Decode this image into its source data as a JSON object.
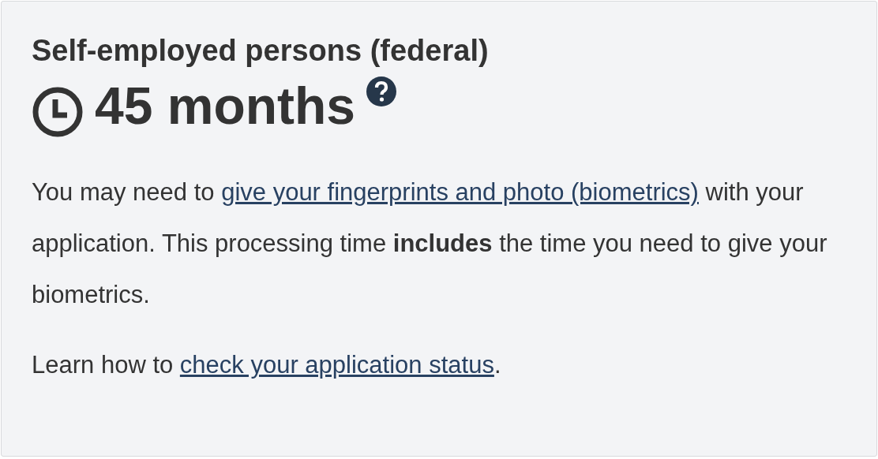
{
  "title": "Self-employed persons (federal)",
  "duration": "45 months",
  "paragraphs": [
    [
      {
        "kind": "text",
        "text": "You may need to "
      },
      {
        "kind": "link",
        "text": "give your fingerprints and photo (biometrics)"
      },
      {
        "kind": "text",
        "text": " with your application. This processing time **includes** the time you need to give your biometrics."
      }
    ],
    [
      {
        "kind": "text",
        "text": "Learn how to "
      },
      {
        "kind": "link",
        "text": "check your application status"
      },
      {
        "kind": "text",
        "text": "."
      }
    ]
  ]
}
